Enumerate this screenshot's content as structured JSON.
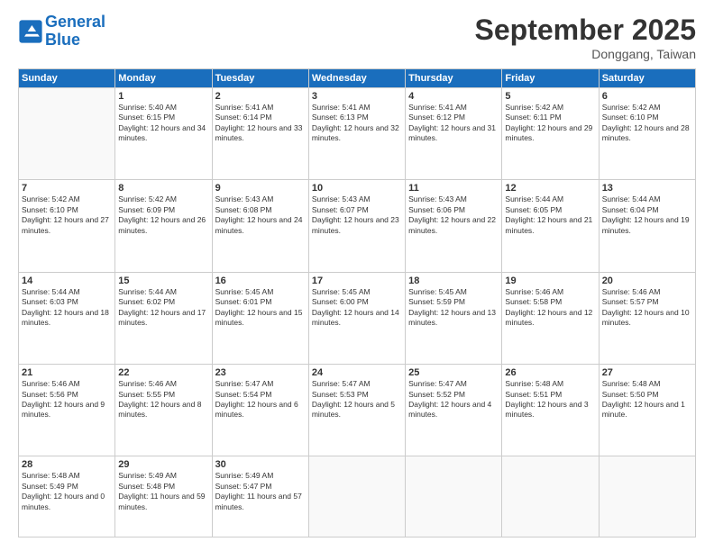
{
  "logo": {
    "line1": "General",
    "line2": "Blue"
  },
  "title": "September 2025",
  "location": "Donggang, Taiwan",
  "days_of_week": [
    "Sunday",
    "Monday",
    "Tuesday",
    "Wednesday",
    "Thursday",
    "Friday",
    "Saturday"
  ],
  "weeks": [
    [
      {
        "day": "",
        "sunrise": "",
        "sunset": "",
        "daylight": ""
      },
      {
        "day": "1",
        "sunrise": "Sunrise: 5:40 AM",
        "sunset": "Sunset: 6:15 PM",
        "daylight": "Daylight: 12 hours and 34 minutes."
      },
      {
        "day": "2",
        "sunrise": "Sunrise: 5:41 AM",
        "sunset": "Sunset: 6:14 PM",
        "daylight": "Daylight: 12 hours and 33 minutes."
      },
      {
        "day": "3",
        "sunrise": "Sunrise: 5:41 AM",
        "sunset": "Sunset: 6:13 PM",
        "daylight": "Daylight: 12 hours and 32 minutes."
      },
      {
        "day": "4",
        "sunrise": "Sunrise: 5:41 AM",
        "sunset": "Sunset: 6:12 PM",
        "daylight": "Daylight: 12 hours and 31 minutes."
      },
      {
        "day": "5",
        "sunrise": "Sunrise: 5:42 AM",
        "sunset": "Sunset: 6:11 PM",
        "daylight": "Daylight: 12 hours and 29 minutes."
      },
      {
        "day": "6",
        "sunrise": "Sunrise: 5:42 AM",
        "sunset": "Sunset: 6:10 PM",
        "daylight": "Daylight: 12 hours and 28 minutes."
      }
    ],
    [
      {
        "day": "7",
        "sunrise": "Sunrise: 5:42 AM",
        "sunset": "Sunset: 6:10 PM",
        "daylight": "Daylight: 12 hours and 27 minutes."
      },
      {
        "day": "8",
        "sunrise": "Sunrise: 5:42 AM",
        "sunset": "Sunset: 6:09 PM",
        "daylight": "Daylight: 12 hours and 26 minutes."
      },
      {
        "day": "9",
        "sunrise": "Sunrise: 5:43 AM",
        "sunset": "Sunset: 6:08 PM",
        "daylight": "Daylight: 12 hours and 24 minutes."
      },
      {
        "day": "10",
        "sunrise": "Sunrise: 5:43 AM",
        "sunset": "Sunset: 6:07 PM",
        "daylight": "Daylight: 12 hours and 23 minutes."
      },
      {
        "day": "11",
        "sunrise": "Sunrise: 5:43 AM",
        "sunset": "Sunset: 6:06 PM",
        "daylight": "Daylight: 12 hours and 22 minutes."
      },
      {
        "day": "12",
        "sunrise": "Sunrise: 5:44 AM",
        "sunset": "Sunset: 6:05 PM",
        "daylight": "Daylight: 12 hours and 21 minutes."
      },
      {
        "day": "13",
        "sunrise": "Sunrise: 5:44 AM",
        "sunset": "Sunset: 6:04 PM",
        "daylight": "Daylight: 12 hours and 19 minutes."
      }
    ],
    [
      {
        "day": "14",
        "sunrise": "Sunrise: 5:44 AM",
        "sunset": "Sunset: 6:03 PM",
        "daylight": "Daylight: 12 hours and 18 minutes."
      },
      {
        "day": "15",
        "sunrise": "Sunrise: 5:44 AM",
        "sunset": "Sunset: 6:02 PM",
        "daylight": "Daylight: 12 hours and 17 minutes."
      },
      {
        "day": "16",
        "sunrise": "Sunrise: 5:45 AM",
        "sunset": "Sunset: 6:01 PM",
        "daylight": "Daylight: 12 hours and 15 minutes."
      },
      {
        "day": "17",
        "sunrise": "Sunrise: 5:45 AM",
        "sunset": "Sunset: 6:00 PM",
        "daylight": "Daylight: 12 hours and 14 minutes."
      },
      {
        "day": "18",
        "sunrise": "Sunrise: 5:45 AM",
        "sunset": "Sunset: 5:59 PM",
        "daylight": "Daylight: 12 hours and 13 minutes."
      },
      {
        "day": "19",
        "sunrise": "Sunrise: 5:46 AM",
        "sunset": "Sunset: 5:58 PM",
        "daylight": "Daylight: 12 hours and 12 minutes."
      },
      {
        "day": "20",
        "sunrise": "Sunrise: 5:46 AM",
        "sunset": "Sunset: 5:57 PM",
        "daylight": "Daylight: 12 hours and 10 minutes."
      }
    ],
    [
      {
        "day": "21",
        "sunrise": "Sunrise: 5:46 AM",
        "sunset": "Sunset: 5:56 PM",
        "daylight": "Daylight: 12 hours and 9 minutes."
      },
      {
        "day": "22",
        "sunrise": "Sunrise: 5:46 AM",
        "sunset": "Sunset: 5:55 PM",
        "daylight": "Daylight: 12 hours and 8 minutes."
      },
      {
        "day": "23",
        "sunrise": "Sunrise: 5:47 AM",
        "sunset": "Sunset: 5:54 PM",
        "daylight": "Daylight: 12 hours and 6 minutes."
      },
      {
        "day": "24",
        "sunrise": "Sunrise: 5:47 AM",
        "sunset": "Sunset: 5:53 PM",
        "daylight": "Daylight: 12 hours and 5 minutes."
      },
      {
        "day": "25",
        "sunrise": "Sunrise: 5:47 AM",
        "sunset": "Sunset: 5:52 PM",
        "daylight": "Daylight: 12 hours and 4 minutes."
      },
      {
        "day": "26",
        "sunrise": "Sunrise: 5:48 AM",
        "sunset": "Sunset: 5:51 PM",
        "daylight": "Daylight: 12 hours and 3 minutes."
      },
      {
        "day": "27",
        "sunrise": "Sunrise: 5:48 AM",
        "sunset": "Sunset: 5:50 PM",
        "daylight": "Daylight: 12 hours and 1 minute."
      }
    ],
    [
      {
        "day": "28",
        "sunrise": "Sunrise: 5:48 AM",
        "sunset": "Sunset: 5:49 PM",
        "daylight": "Daylight: 12 hours and 0 minutes."
      },
      {
        "day": "29",
        "sunrise": "Sunrise: 5:49 AM",
        "sunset": "Sunset: 5:48 PM",
        "daylight": "Daylight: 11 hours and 59 minutes."
      },
      {
        "day": "30",
        "sunrise": "Sunrise: 5:49 AM",
        "sunset": "Sunset: 5:47 PM",
        "daylight": "Daylight: 11 hours and 57 minutes."
      },
      {
        "day": "",
        "sunrise": "",
        "sunset": "",
        "daylight": ""
      },
      {
        "day": "",
        "sunrise": "",
        "sunset": "",
        "daylight": ""
      },
      {
        "day": "",
        "sunrise": "",
        "sunset": "",
        "daylight": ""
      },
      {
        "day": "",
        "sunrise": "",
        "sunset": "",
        "daylight": ""
      }
    ]
  ]
}
